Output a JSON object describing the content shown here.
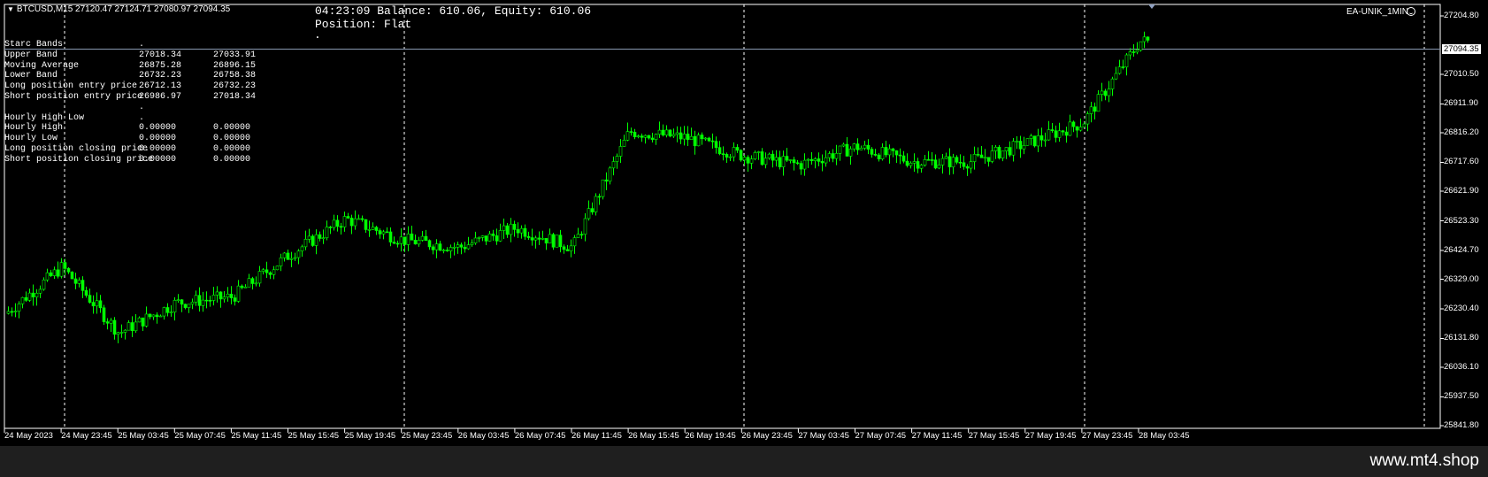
{
  "header": {
    "symbol_line": "BTCUSD,M15  27120.47 27124.71 27080.97 27094.35",
    "account_line": "04:23:09 Balance: 610.06, Equity: 610.06",
    "position_line": "Position: Flat",
    "position_dot": ".",
    "ea_name": "EA-UNIK_1MIN"
  },
  "starc_table": [
    [
      "Starc Bands",
      ".",
      ""
    ],
    [
      "Upper Band",
      "27018.34",
      "27033.91"
    ],
    [
      "Moving Average",
      "26875.28",
      "26896.15"
    ],
    [
      "Lower Band",
      "26732.23",
      "26758.38"
    ],
    [
      "Long position entry price",
      "26712.13",
      "26732.23"
    ],
    [
      "Short position entry price",
      "26986.97",
      "27018.34"
    ],
    [
      "",
      ".",
      ""
    ],
    [
      "Hourly High Low",
      ".",
      ""
    ],
    [
      "Hourly High",
      "0.00000",
      "0.00000"
    ],
    [
      "Hourly Low",
      "0.00000",
      "0.00000"
    ],
    [
      "Long position closing price",
      "0.00000",
      "0.00000"
    ],
    [
      "Short position closing price",
      "0.00000",
      "0.00000"
    ]
  ],
  "price_axis": [
    "27204.80",
    "27094.35",
    "27010.50",
    "26911.90",
    "26816.20",
    "26717.60",
    "26621.90",
    "26523.30",
    "26424.70",
    "26329.00",
    "26230.40",
    "26131.80",
    "26036.10",
    "25937.50",
    "25841.80"
  ],
  "current_price": "27094.35",
  "time_axis": [
    "24 May 2023",
    "24 May 23:45",
    "25 May 03:45",
    "25 May 07:45",
    "25 May 11:45",
    "25 May 15:45",
    "25 May 19:45",
    "25 May 23:45",
    "26 May 03:45",
    "26 May 07:45",
    "26 May 11:45",
    "26 May 15:45",
    "26 May 19:45",
    "26 May 23:45",
    "27 May 03:45",
    "27 May 07:45",
    "27 May 11:45",
    "27 May 15:45",
    "27 May 19:45",
    "27 May 23:45",
    "28 May 03:45"
  ],
  "watermark": "www.mt4.shop",
  "colors": {
    "candle": "#00ff00",
    "background": "#000000",
    "grid": "#ffffff"
  },
  "chart_data": {
    "type": "line",
    "title": "BTCUSD,M15",
    "ylim": [
      25841.8,
      27204.8
    ],
    "current_price": 27094.35,
    "x": [
      "24 May 2023",
      "24 May 23:45",
      "25 May 03:45",
      "25 May 07:45",
      "25 May 11:45",
      "25 May 15:45",
      "25 May 19:45",
      "25 May 23:45",
      "26 May 03:45",
      "26 May 07:45",
      "26 May 11:45",
      "26 May 15:45",
      "26 May 19:45",
      "26 May 23:45",
      "27 May 03:45",
      "27 May 07:45",
      "27 May 11:45",
      "27 May 15:45",
      "27 May 19:45",
      "27 May 23:45",
      "28 May 03:45"
    ],
    "series": [
      {
        "values": [
          26215,
          26370,
          26150,
          26250,
          26270,
          26410,
          26530,
          26460,
          26435,
          26500,
          26435,
          26820,
          26800,
          26740,
          26710,
          26770,
          26720,
          26720,
          26780,
          26850,
          27120
        ]
      }
    ]
  }
}
